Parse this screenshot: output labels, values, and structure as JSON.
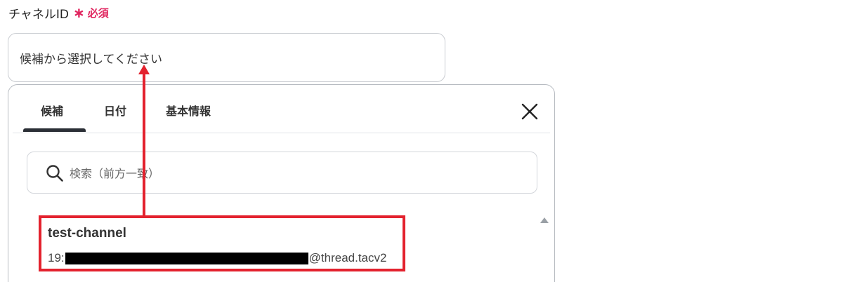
{
  "field": {
    "label": "チャネルID",
    "required_star": "∗",
    "required_text": "必須",
    "input_value": "候補から選択してください"
  },
  "dropdown": {
    "tabs": [
      {
        "label": "候補"
      },
      {
        "label": "日付"
      },
      {
        "label": "基本情報"
      }
    ],
    "active_tab": "候補",
    "close_icon": "close-icon",
    "search": {
      "placeholder": "検索（前方一致）",
      "icon": "search-icon"
    },
    "options": [
      {
        "title": "test-channel",
        "id_prefix": "19:",
        "id_suffix": "@thread.tacv2"
      }
    ]
  },
  "colors": {
    "required": "#e0245e",
    "annotation": "#e3222e",
    "tab_indicator": "#2b2f36"
  }
}
